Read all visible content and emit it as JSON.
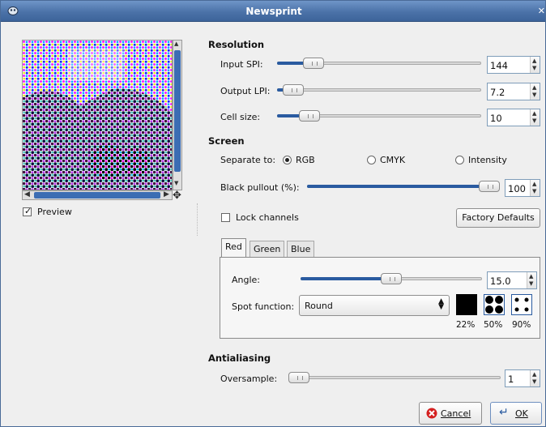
{
  "window": {
    "title": "Newsprint"
  },
  "preview": {
    "label": "Preview",
    "checked": true
  },
  "resolution": {
    "heading": "Resolution",
    "input_spi": {
      "label": "Input SPI:",
      "value": "144",
      "fraction": 0.14
    },
    "output_lpi": {
      "label": "Output LPI:",
      "value": "7.2",
      "fraction": 0.03
    },
    "cell_size": {
      "label": "Cell size:",
      "value": "10",
      "fraction": 0.12
    }
  },
  "screen": {
    "heading": "Screen",
    "separate_label": "Separate to:",
    "options": [
      "RGB",
      "CMYK",
      "Intensity"
    ],
    "selected": "RGB",
    "black_pullout": {
      "label": "Black pullout (%):",
      "value": "100",
      "fraction": 1.0
    },
    "lock_channels": {
      "label": "Lock channels",
      "checked": false
    },
    "factory_defaults": "Factory Defaults",
    "tabs": [
      "Red",
      "Green",
      "Blue"
    ],
    "active_tab": "Red",
    "angle": {
      "label": "Angle:",
      "value": "15.0",
      "fraction": 0.5
    },
    "spot_function": {
      "label": "Spot function:",
      "value": "Round"
    },
    "spot_previews": [
      "22%",
      "50%",
      "90%"
    ]
  },
  "antialiasing": {
    "heading": "Antialiasing",
    "oversample": {
      "label": "Oversample:",
      "value": "1",
      "fraction": 0.0
    }
  },
  "buttons": {
    "cancel": "Cancel",
    "ok": "OK"
  },
  "colors": {
    "accent": "#2a5ba0",
    "titlebar": "#4b72a8",
    "cancel_icon": "#d42020"
  }
}
